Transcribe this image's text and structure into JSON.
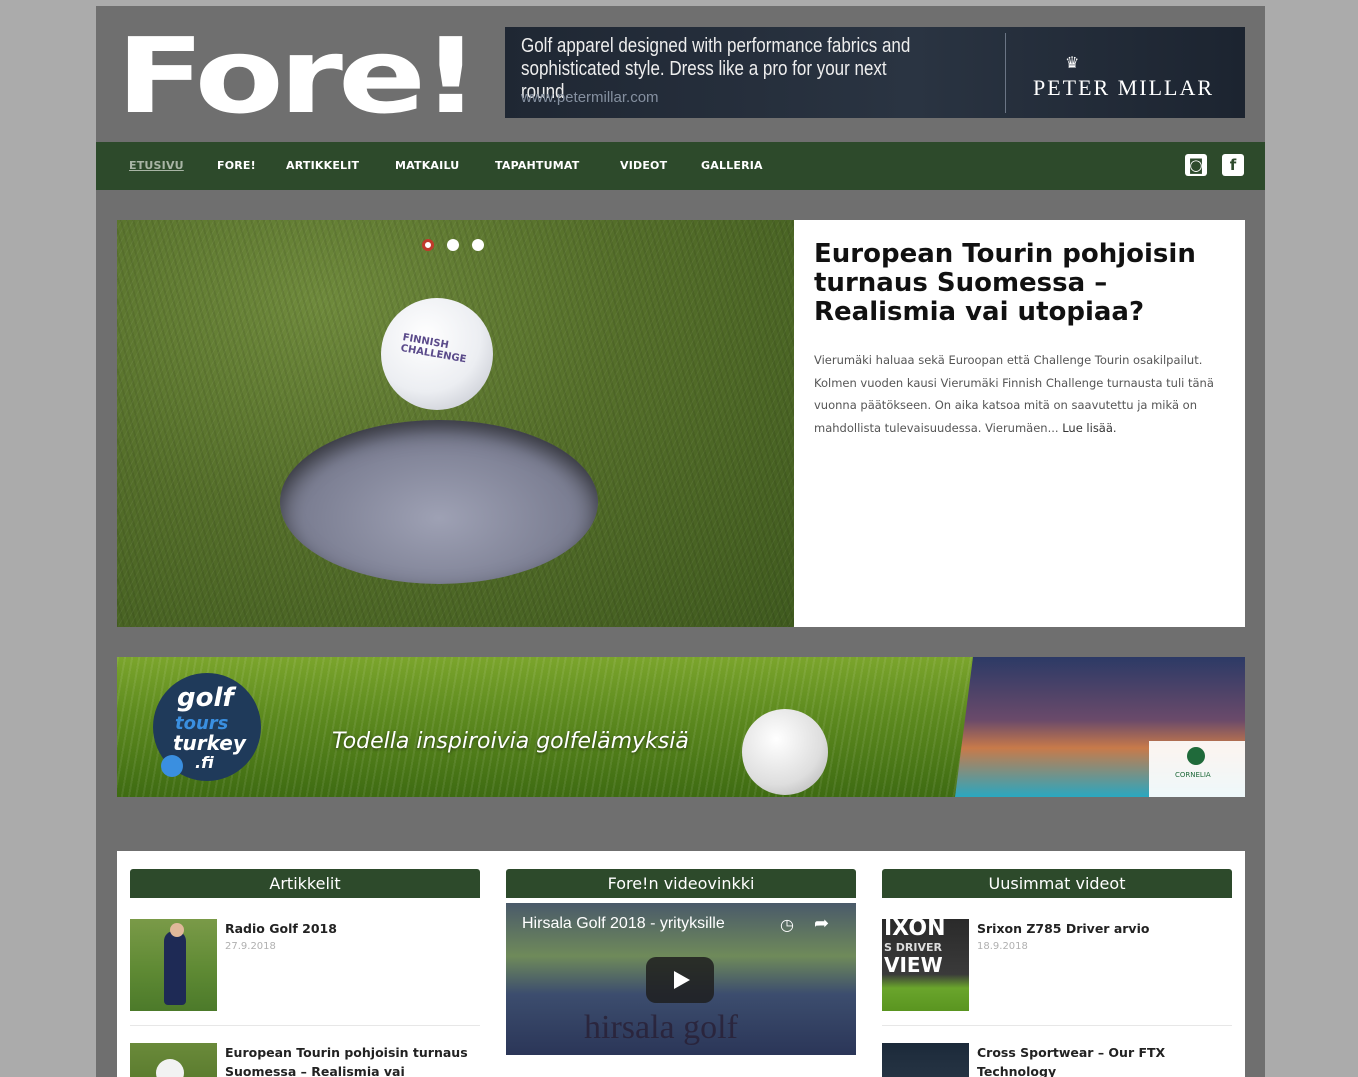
{
  "site": {
    "logo": "Fore!"
  },
  "ad": {
    "text": "Golf apparel designed with performance fabrics and sophisticated style. Dress like a pro for your next round.",
    "url": "www.petermillar.com",
    "brand": "PETER MILLAR",
    "crown_icon": "crown-icon"
  },
  "nav": {
    "items": [
      {
        "label": "ETUSIVU",
        "active": true
      },
      {
        "label": "FORE!",
        "active": false
      },
      {
        "label": "ARTIKKELIT",
        "active": false
      },
      {
        "label": "MATKAILU",
        "active": false
      },
      {
        "label": "TAPAHTUMAT",
        "active": false
      },
      {
        "label": "VIDEOT",
        "active": false
      },
      {
        "label": "GALLERIA",
        "active": false
      }
    ],
    "social": [
      {
        "icon": "instagram-icon",
        "glyph": "◙"
      },
      {
        "icon": "facebook-icon",
        "glyph": "f"
      }
    ]
  },
  "hero": {
    "title": "European Tourin pohjoisin turnaus Suomessa – Realismia vai utopiaa?",
    "body": "Vierumäki haluaa sekä Euroopan että Challenge Tourin osakilpailut. Kolmen vuoden kausi Vierumäki Finnish Challenge turnausta tuli tänä vuonna päätökseen. On aika katsoa mitä on saavutettu ja mikä on mahdollista tulevaisuudessa. Vierumäen...",
    "more": "Lue lisää.",
    "ball_text": "FINNISH CHALLENGE",
    "slides": 3,
    "active_slide": 0
  },
  "banner": {
    "logo_golf": "golf",
    "logo_tours": "tours",
    "logo_turkey": "turkey",
    "logo_fi": ".fi",
    "slogan": "Todella inspiroivia golfelämyksiä",
    "hotel_badge": "CORNELIA"
  },
  "columns": {
    "articles": {
      "header": "Artikkelit",
      "posts": [
        {
          "title": "Radio Golf 2018",
          "date": "27.9.2018"
        },
        {
          "title": "European Tourin pohjoisin turnaus Suomessa – Realismia vai",
          "date": ""
        }
      ]
    },
    "video_tip": {
      "header": "Fore!n videovinkki",
      "video_title": "Hirsala Golf 2018 - yrityksille",
      "video_brand": "hirsala golf",
      "clock_icon": "clock-icon",
      "share_icon": "share-icon"
    },
    "latest_videos": {
      "header": "Uusimmat videot",
      "posts": [
        {
          "title": "Srixon Z785 Driver arvio",
          "date": "18.9.2018",
          "thumb_text": "IXON\nS DRIVER\nVIEW"
        },
        {
          "title": "Cross Sportwear – Our FTX Technology",
          "date": ""
        }
      ]
    }
  }
}
